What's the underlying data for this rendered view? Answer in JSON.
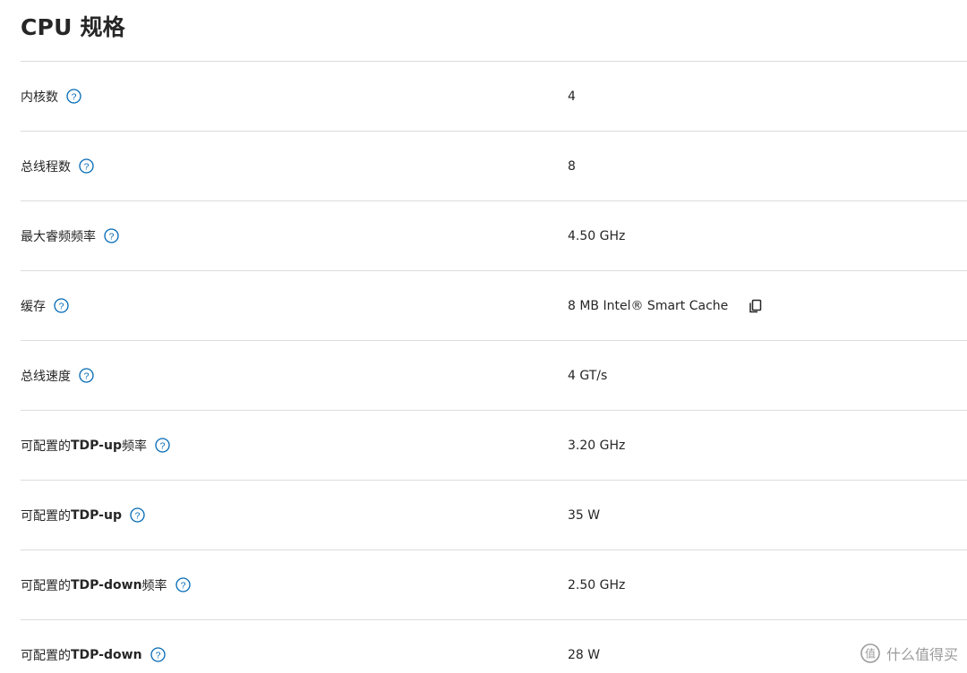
{
  "page": {
    "title": "CPU 规格"
  },
  "specs": [
    {
      "label": "内核数",
      "label_bold": "",
      "label_suffix": "",
      "value": "4"
    },
    {
      "label": "总线程数",
      "label_bold": "",
      "label_suffix": "",
      "value": "8"
    },
    {
      "label": "最大睿频频率",
      "label_bold": "",
      "label_suffix": "",
      "value": "4.50 GHz"
    },
    {
      "label": "缓存",
      "label_bold": "",
      "label_suffix": "",
      "value": "8 MB Intel® Smart Cache"
    },
    {
      "label": "总线速度",
      "label_bold": "",
      "label_suffix": "",
      "value": "4 GT/s"
    },
    {
      "label": "可配置的 ",
      "label_bold": "TDP-up",
      "label_suffix": " 频率",
      "value": "3.20 GHz"
    },
    {
      "label": "可配置的 ",
      "label_bold": "TDP-up",
      "label_suffix": "",
      "value": "35 W"
    },
    {
      "label": "可配置的 ",
      "label_bold": "TDP-down",
      "label_suffix": " 频率",
      "value": "2.50 GHz"
    },
    {
      "label": "可配置的 ",
      "label_bold": "TDP-down",
      "label_suffix": "",
      "value": "28 W"
    }
  ],
  "icons": {
    "help": "help-circle-icon",
    "copy": "copy-icon"
  },
  "colors": {
    "accent": "#0068b5",
    "divider": "#dcdcdc",
    "text": "#262626"
  },
  "watermark": {
    "text": "什么值得买"
  }
}
